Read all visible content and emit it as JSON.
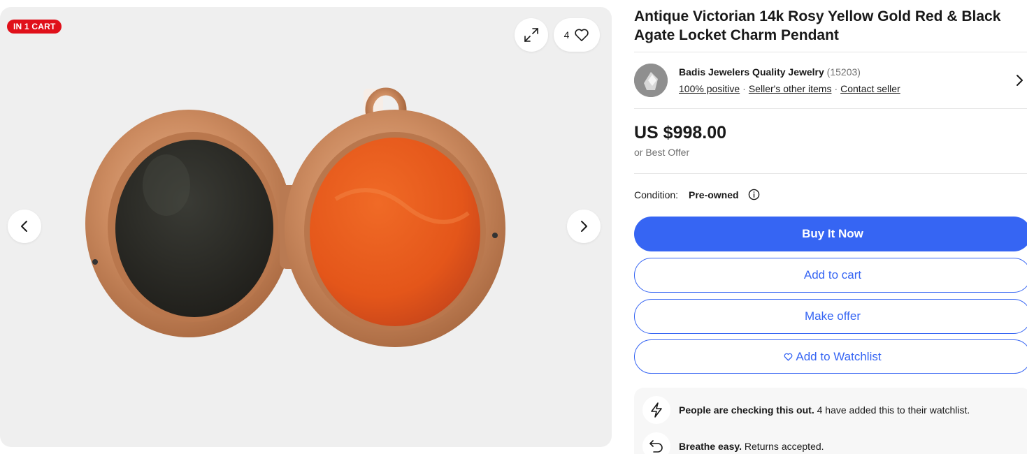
{
  "gallery": {
    "cart_badge": "IN 1 CART",
    "watch_count": "4",
    "icons": {
      "expand": "expand-icon",
      "heart": "heart-icon",
      "prev": "chevron-left-icon",
      "next": "chevron-right-icon"
    },
    "image_subject": "product-photo"
  },
  "product": {
    "title": "Antique Victorian 14k Rosy Yellow Gold Red & Black Agate Locket Charm Pendant",
    "price": "US $998.00",
    "best_offer": "or Best Offer",
    "condition_label": "Condition:",
    "condition_value": "Pre-owned"
  },
  "seller": {
    "name": "Badis Jewelers Quality Jewelry",
    "feedback_count": "(15203)",
    "positive": "100% positive",
    "other_items": "Seller's other items",
    "contact": "Contact seller"
  },
  "actions": {
    "buy_now": "Buy It Now",
    "add_to_cart": "Add to cart",
    "make_offer": "Make offer",
    "add_to_watchlist": "Add to Watchlist"
  },
  "signals": [
    {
      "icon": "lightning-icon",
      "bold": "People are checking this out.",
      "text": " 4 have added this to their watchlist."
    },
    {
      "icon": "return-arrow-icon",
      "bold": "Breathe easy.",
      "text": " Returns accepted."
    }
  ],
  "colors": {
    "accent": "#3665f3",
    "badge": "#e0101a",
    "gallery_bg": "#efefef",
    "gold": "#c98c64",
    "agate_black": "#2b2b27",
    "agate_red": "#e8581b"
  }
}
